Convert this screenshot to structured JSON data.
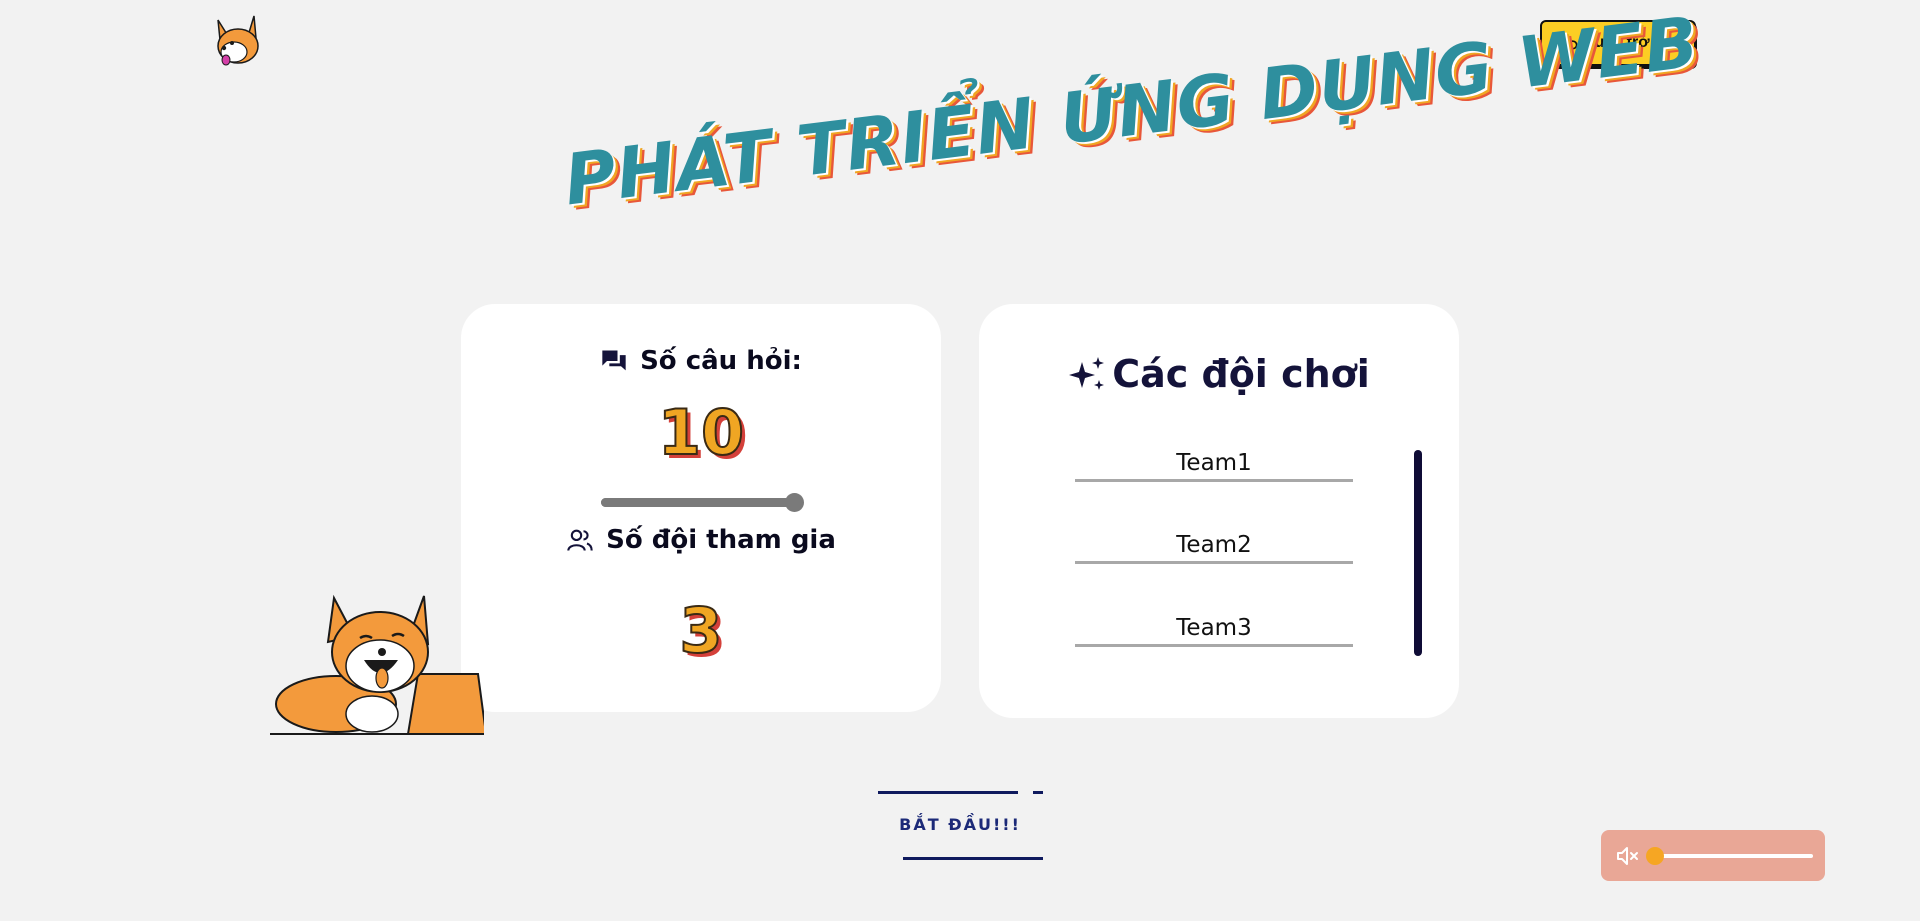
{
  "header": {
    "logo_icon": "corgi-logo-icon",
    "back_button_label": "Quay trở lại",
    "back_icon": "undo-icon"
  },
  "title": "PHÁT TRIỂN ỨNG DỤNG WEB",
  "settings": {
    "questions_label": "Số câu hỏi:",
    "questions_icon": "chat-bubbles-icon",
    "questions_value": "10",
    "questions_slider_fraction": 1.0,
    "teams_label": "Số đội tham gia",
    "teams_icon": "users-icon",
    "teams_value": "3"
  },
  "teams": {
    "heading": "Các đội chơi",
    "heading_icon": "sparkles-icon",
    "names": [
      "Team1",
      "Team2",
      "Team3"
    ]
  },
  "start_button_label": "BẮT ĐẦU!!!",
  "audio": {
    "mute_icon": "speaker-muted-icon",
    "volume_fraction": 0.0
  },
  "colors": {
    "background": "#f2f2f2",
    "accent_yellow": "#fcce24",
    "number_orange": "#f0a623",
    "title_teal": "#2e8f9e",
    "navy": "#14133a",
    "audio_panel": "#e9a796"
  }
}
